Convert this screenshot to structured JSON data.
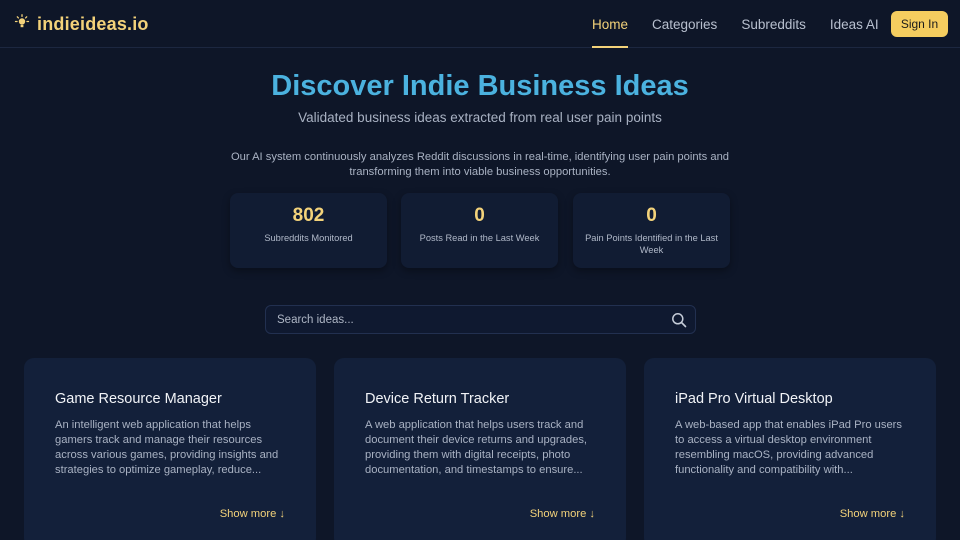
{
  "header": {
    "brand": "indieideas.io",
    "nav": [
      {
        "label": "Home",
        "active": true
      },
      {
        "label": "Categories",
        "active": false
      },
      {
        "label": "Subreddits",
        "active": false
      },
      {
        "label": "Ideas AI",
        "active": false
      }
    ],
    "signin_label": "Sign In"
  },
  "hero": {
    "title": "Discover Indie Business Ideas",
    "subtitle": "Validated business ideas extracted from real user pain points",
    "description": "Our AI system continuously analyzes Reddit discussions in real-time, identifying user pain points and transforming them into viable business opportunities."
  },
  "stats": [
    {
      "value": "802",
      "label": "Subreddits Monitored"
    },
    {
      "value": "0",
      "label": "Posts Read in the Last Week"
    },
    {
      "value": "0",
      "label": "Pain Points Identified in the Last Week"
    }
  ],
  "search": {
    "placeholder": "Search ideas..."
  },
  "cards": [
    {
      "title": "Game Resource Manager",
      "description": "An intelligent web application that helps gamers track and manage their resources across various games, providing insights and strategies to optimize gameplay, reduce...",
      "more_label": "Show more ↓"
    },
    {
      "title": "Device Return Tracker",
      "description": "A web application that helps users track and document their device returns and upgrades, providing them with digital receipts, photo documentation, and timestamps to ensure...",
      "more_label": "Show more ↓"
    },
    {
      "title": "iPad Pro Virtual Desktop",
      "description": "A web-based app that enables iPad Pro users to access a virtual desktop environment resembling macOS, providing advanced functionality and compatibility with...",
      "more_label": "Show more ↓"
    }
  ],
  "colors": {
    "background": "#0e1628",
    "accent": "#f3d27a",
    "title_blue": "#4bb2df",
    "button": "#f5cd5f"
  }
}
